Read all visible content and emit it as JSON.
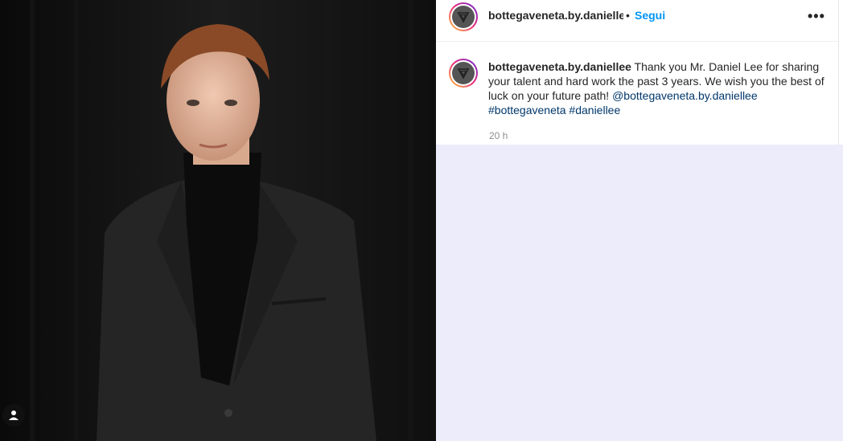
{
  "post": {
    "username": "bottegaveneta.by.daniellee",
    "separator": "•",
    "follow_label": "Segui",
    "more_label": "•••",
    "caption_text": "Thank you Mr. Daniel Lee for sharing your talent and hard work the past 3 years. We wish you the best of luck on your future path!",
    "mention": "@bottegaveneta.by.daniellee",
    "hashtag1": "#bottegaveneta",
    "hashtag2": "#daniellee",
    "timestamp": "20 h"
  },
  "icons": {
    "more": "more-options-icon",
    "tag": "user-tag-icon",
    "logo": "bottega-logo-icon"
  },
  "colors": {
    "follow": "#0095f6",
    "link": "#00376b",
    "ring_start": "#f9ce34",
    "ring_end": "#6228d7"
  }
}
